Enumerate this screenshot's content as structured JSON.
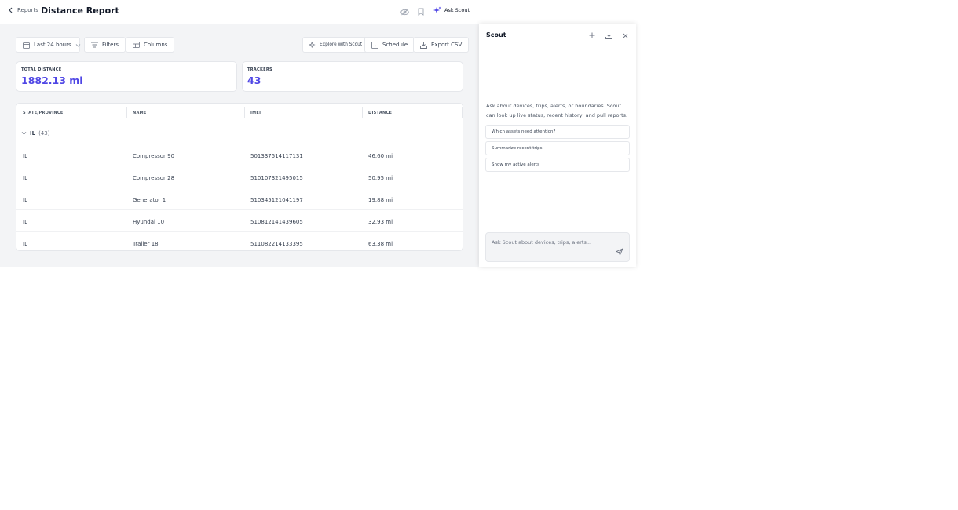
{
  "header": {
    "back_label": "Reports",
    "title": "Distance Report",
    "ask_scout_label": "Ask Scout"
  },
  "toolbar": {
    "time_range": "Last 24 hours",
    "filters_label": "Filters",
    "columns_label": "Columns",
    "explore_label": "Explore with Scout",
    "schedule_label": "Schedule",
    "export_label": "Export CSV"
  },
  "summary": {
    "total_distance_label": "TOTAL DISTANCE",
    "total_distance_value": "1882.13 mi",
    "trackers_label": "TRACKERS",
    "trackers_value": "43"
  },
  "table": {
    "columns": [
      "STATE/PROVINCE",
      "NAME",
      "IMEI",
      "DISTANCE"
    ],
    "group": {
      "state": "IL",
      "count": "(43)"
    },
    "rows": [
      {
        "state": "IL",
        "name": "Compressor 90",
        "imei": "501337514117131",
        "distance": "46.60 mi"
      },
      {
        "state": "IL",
        "name": "Compressor 28",
        "imei": "510107321495015",
        "distance": "50.95 mi"
      },
      {
        "state": "IL",
        "name": "Generator 1",
        "imei": "510345121041197",
        "distance": "19.88 mi"
      },
      {
        "state": "IL",
        "name": "Hyundai 10",
        "imei": "510812141439605",
        "distance": "32.93 mi"
      },
      {
        "state": "IL",
        "name": "Trailer 18",
        "imei": "511082214133395",
        "distance": "63.38 mi"
      }
    ]
  },
  "scout": {
    "title": "Scout",
    "intro": "Ask about devices, trips, alerts, or boundaries. Scout can look up live status, recent history, and pull reports.",
    "suggestions": [
      "Which assets need attention?",
      "Summarize recent trips",
      "Show my active alerts"
    ],
    "input_placeholder": "Ask Scout about devices, trips, alerts..."
  },
  "colors": {
    "accent": "#4f46e5",
    "background": "#f3f4f6"
  }
}
